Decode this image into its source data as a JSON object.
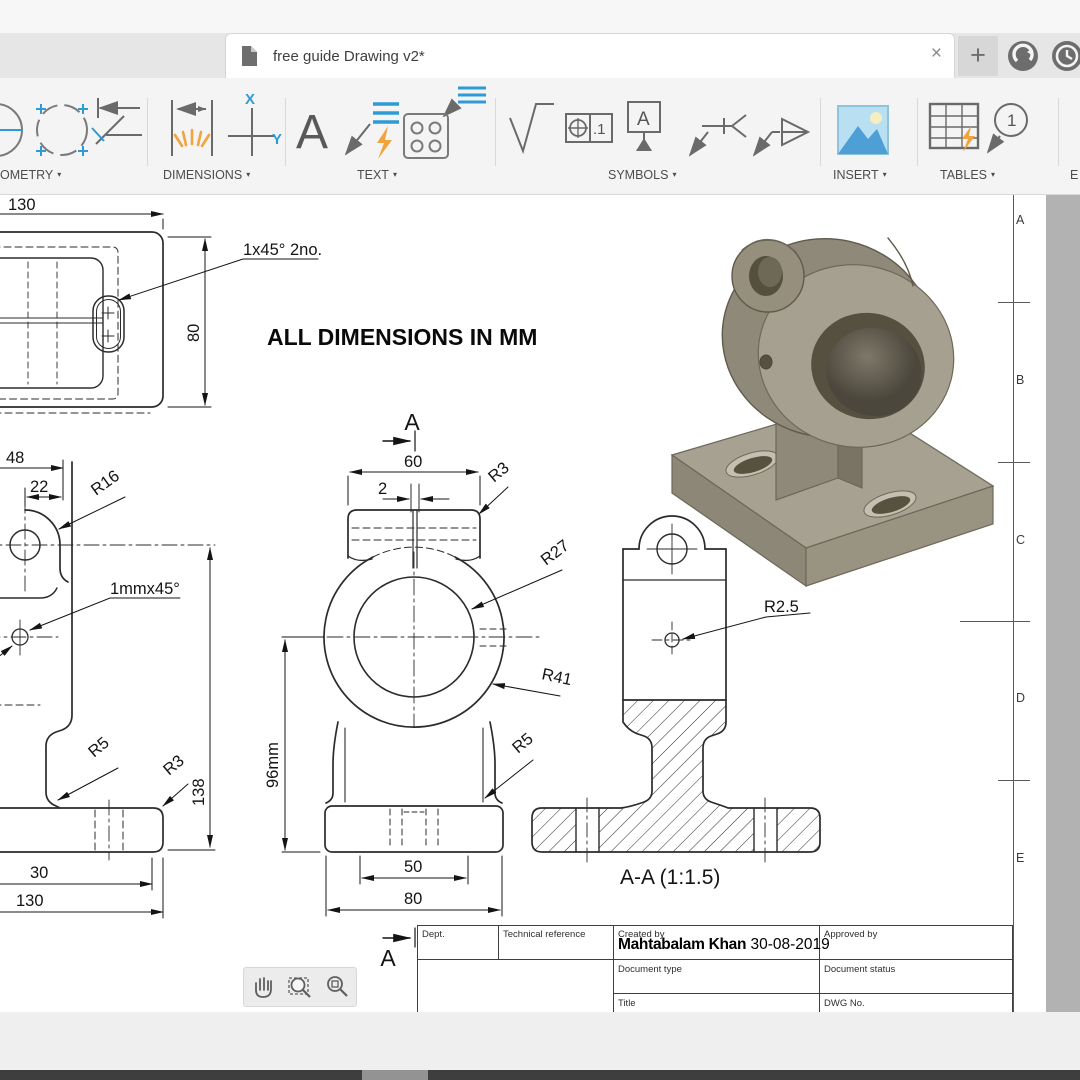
{
  "colors": {
    "accent_blue": "#2f9bd6",
    "accent_orange": "#f2a33c",
    "line": "#2b2b2b"
  },
  "window": {
    "tab_title": "free guide Drawing v2*",
    "close_glyph": "×",
    "new_tab_glyph": "+"
  },
  "toolbar": {
    "caret": "▾",
    "groups": [
      {
        "label": "OMETRY"
      },
      {
        "label": "DIMENSIONS"
      },
      {
        "label": "TEXT"
      },
      {
        "label": "SYMBOLS"
      },
      {
        "label": "INSERT"
      },
      {
        "label": "TABLES"
      },
      {
        "label": "E"
      }
    ],
    "icon_glyphs": {
      "ordinate_x": "X",
      "ordinate_y": "Y",
      "text_a": "A",
      "fcf_tol": ".1",
      "datum": "A",
      "balloon": "1"
    }
  },
  "drawing": {
    "note": "ALL DIMENSIONS IN MM",
    "section_title": "A-A (1:1.5)",
    "zones": [
      "A",
      "B",
      "C",
      "D",
      "E"
    ],
    "dims": {
      "d130_top": "130",
      "d80_top": "80",
      "chamfer_slot": "1x45° 2no.",
      "d48": "48",
      "d22": "22",
      "r16": "R16",
      "chamfer_hole": "1mmx45°",
      "d138": "138",
      "d30": "30",
      "d130_bottom": "130",
      "sec_a_top": "A",
      "d60": "60",
      "d2": "2",
      "r3_block": "R3",
      "r27": "R27",
      "r41": "R41",
      "d96": "96mm",
      "r5_front": "R5",
      "d50": "50",
      "d80_front": "80",
      "sec_a_bottom": "A",
      "r5_side": "R5",
      "r3_side": "R3",
      "r2_5": "R2.5"
    },
    "title_block": {
      "dept_label": "Dept.",
      "tech_ref_label": "Technical reference",
      "created_by_label": "Created by",
      "created_by_name": "Mahtabalam Khan",
      "created_date": " 30-08-2019",
      "approved_label": "Approved by",
      "doc_type_label": "Document type",
      "doc_status_label": "Document status",
      "title_label": "Title",
      "dwg_label": "DWG No."
    }
  }
}
